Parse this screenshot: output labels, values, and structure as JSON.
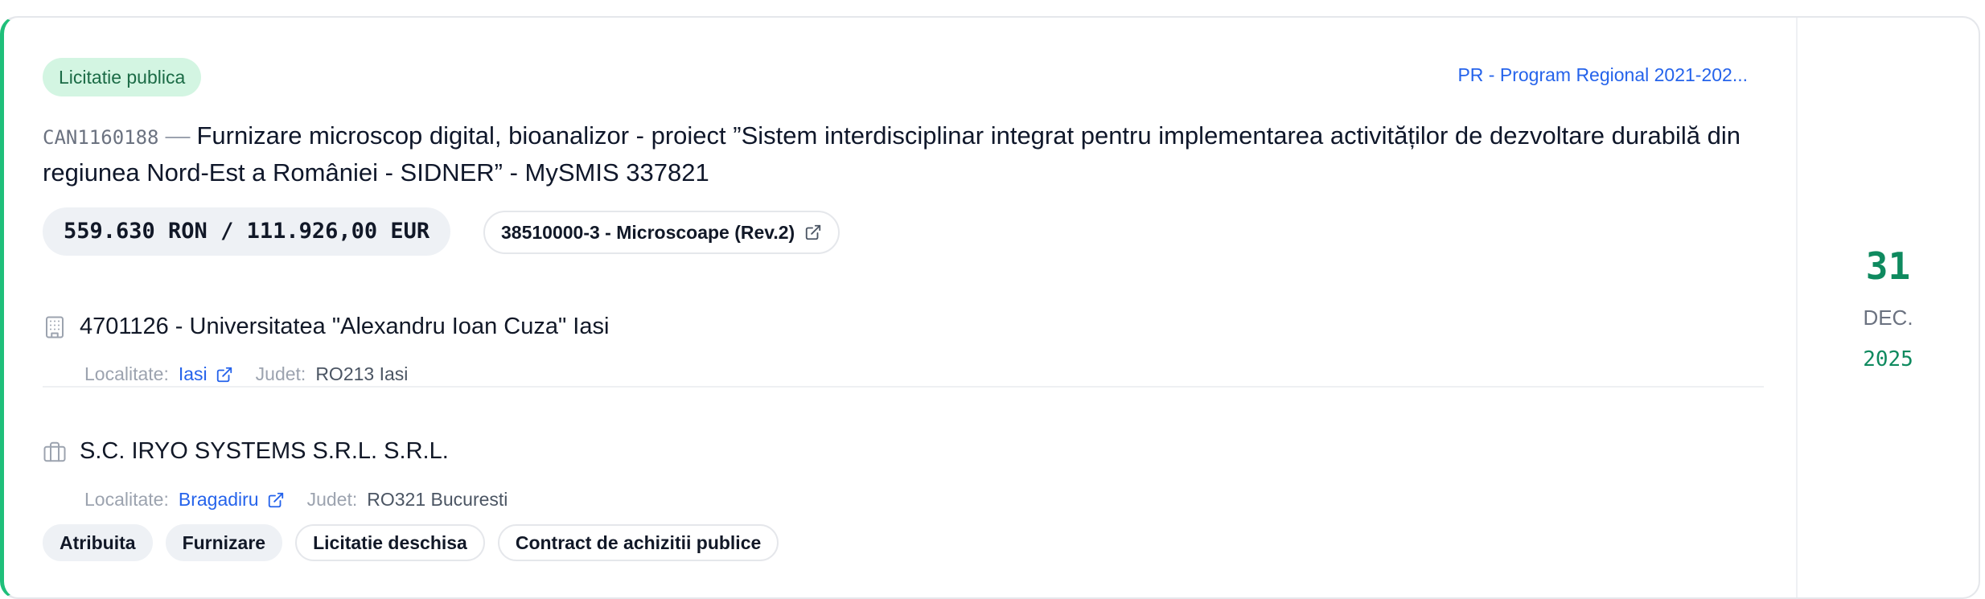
{
  "procedure_badge": "Licitatie publica",
  "program": "PR - Program Regional 2021-202...",
  "notice": {
    "code": "CAN1160188",
    "separator": "—",
    "title": "Furnizare microscop digital, bioanalizor - proiect ”Sistem interdisciplinar integrat pentru implementarea activităților de dezvoltare durabilă din regiunea Nord-Est a României - SIDNER” - MySMIS 337821"
  },
  "value": "559.630 RON / 111.926,00 EUR",
  "cpv": "38510000-3 - Microscoape (Rev.2)",
  "authority": {
    "icon": "building-icon",
    "name": "4701126 - Universitatea \"Alexandru Ioan Cuza\" Iasi",
    "locality_label": "Localitate:",
    "locality": "Iasi",
    "county_label": "Judet:",
    "county": "RO213 Iasi"
  },
  "supplier": {
    "icon": "briefcase-icon",
    "name": "S.C. IRYO SYSTEMS S.R.L. S.R.L.",
    "locality_label": "Localitate:",
    "locality": "Bragadiru",
    "county_label": "Judet:",
    "county": "RO321 Bucuresti"
  },
  "tags": [
    "Atribuita",
    "Furnizare",
    "Licitatie deschisa",
    "Contract de achizitii publice"
  ],
  "date": {
    "day": "31",
    "month": "DEC.",
    "year": "2025"
  },
  "colors": {
    "accent": "#1fbf7a",
    "link": "#2563eb",
    "date": "#0f8a5f"
  }
}
